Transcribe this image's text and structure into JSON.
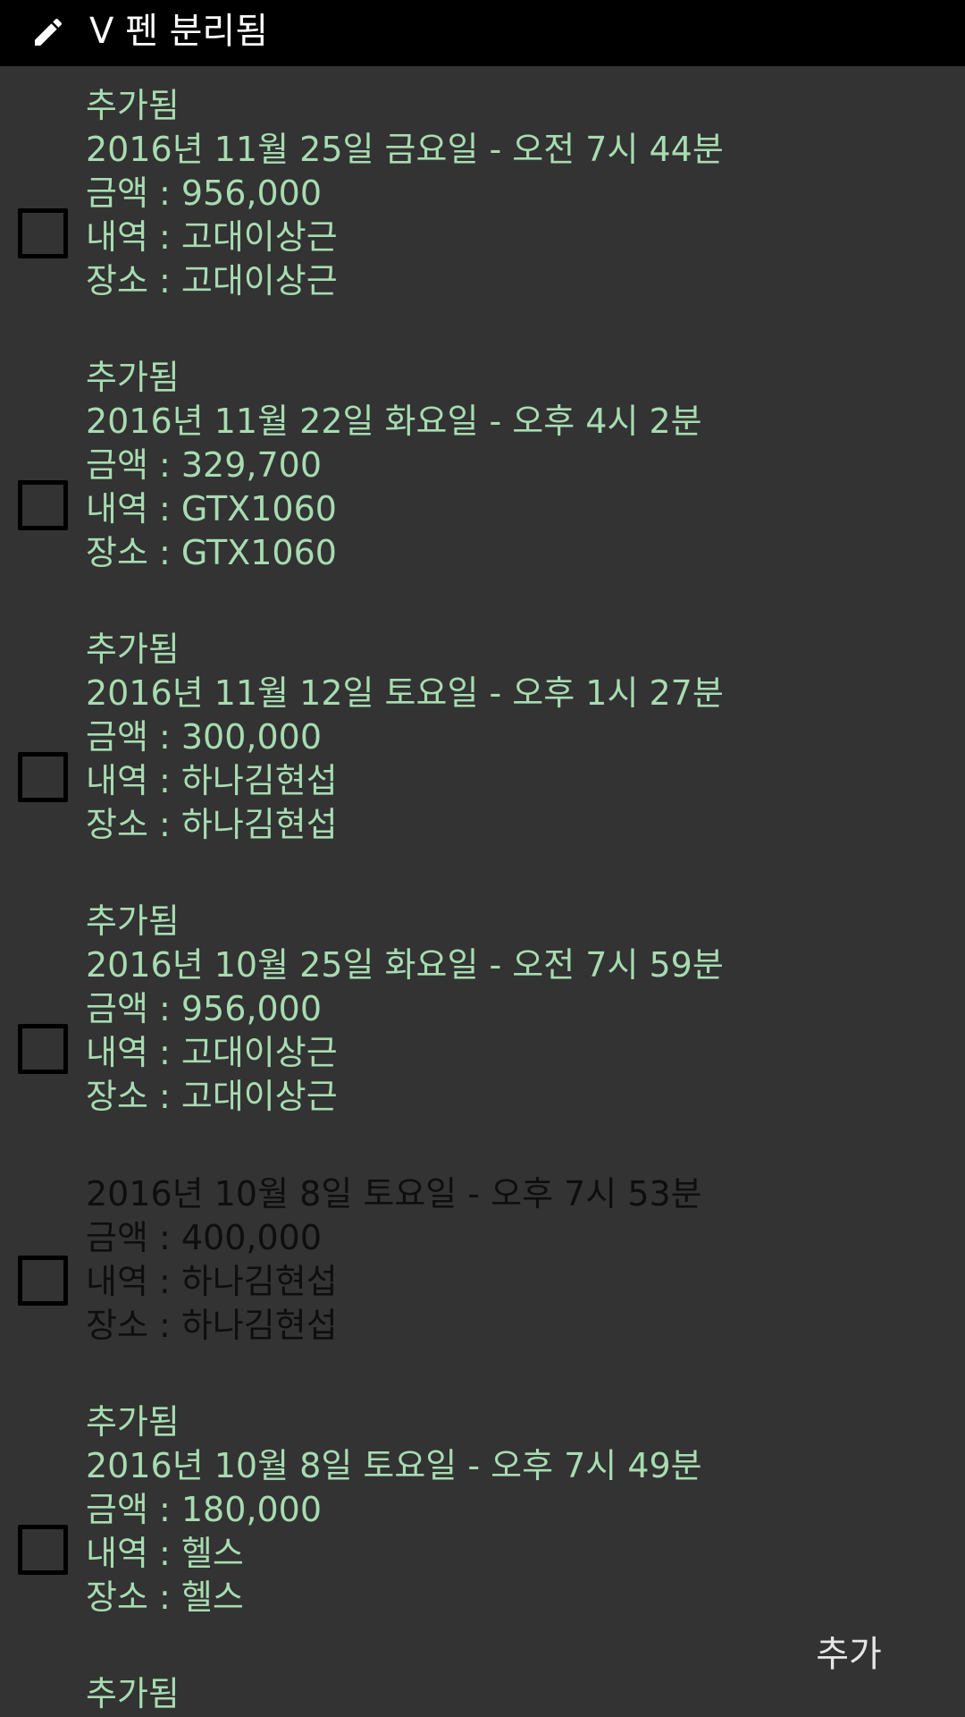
{
  "status_bar": {
    "text": "V 펜 분리됨",
    "icon": "pen-icon"
  },
  "colors": {
    "background": "#333333",
    "status_bar": "#000000",
    "added_text": "#a7dcb1",
    "plain_text": "#0e0e0e"
  },
  "entries": [
    {
      "added_label": "추가됨",
      "date": "2016년 11월 25일 금요일 - 오전 7시 44분",
      "amount": "금액 : 956,000",
      "detail": "내역 : 고대이상근",
      "place": "장소 : 고대이상근"
    },
    {
      "added_label": "추가됨",
      "date": "2016년 11월 22일 화요일 - 오후 4시 2분",
      "amount": "금액 : 329,700",
      "detail": "내역 : GTX1060",
      "place": "장소 : GTX1060"
    },
    {
      "added_label": "추가됨",
      "date": "2016년 11월 12일 토요일 - 오후 1시 27분",
      "amount": "금액 : 300,000",
      "detail": "내역 : 하나김현섭",
      "place": "장소 : 하나김현섭"
    },
    {
      "added_label": "추가됨",
      "date": "2016년 10월 25일 화요일 - 오전 7시 59분",
      "amount": "금액 : 956,000",
      "detail": "내역 : 고대이상근",
      "place": "장소 : 고대이상근"
    },
    {
      "date": "2016년 10월 8일 토요일 - 오후 7시 53분",
      "amount": "금액 : 400,000",
      "detail": "내역 : 하나김현섭",
      "place": "장소 : 하나김현섭"
    },
    {
      "added_label": "추가됨",
      "date": "2016년 10월 8일 토요일 - 오후 7시 49분",
      "amount": "금액 : 180,000",
      "detail": "내역 : 헬스",
      "place": "장소 : 헬스"
    },
    {
      "added_label": "추가됨"
    }
  ],
  "add_button": {
    "label": "추가"
  }
}
